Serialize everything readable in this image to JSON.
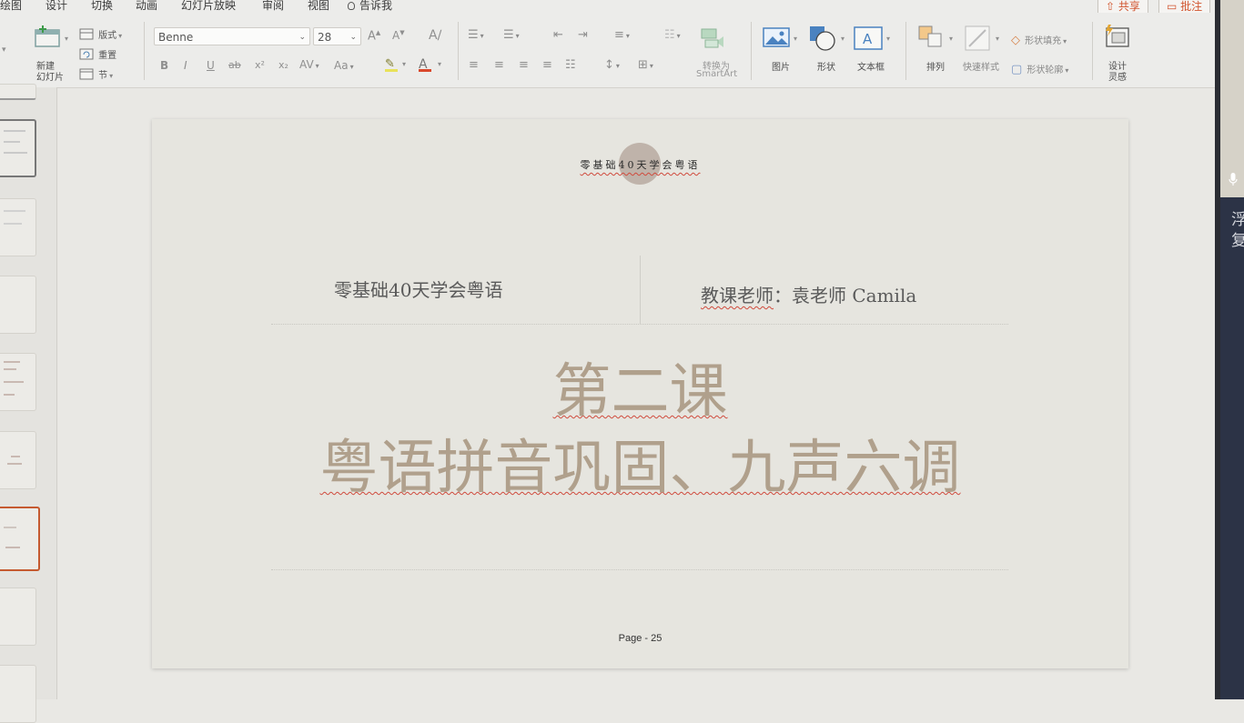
{
  "menubar": {
    "items": [
      "绘图",
      "设计",
      "切换",
      "动画",
      "幻灯片放映",
      "审阅",
      "视图"
    ],
    "tell_me": "告诉我",
    "share": "共享",
    "comments": "批注"
  },
  "ribbon": {
    "new_slide_line1": "新建",
    "new_slide_line2": "幻灯片",
    "layout": "版式",
    "reset": "重置",
    "section": "节",
    "font_name": "Benne",
    "font_size": "28",
    "format_buttons": [
      "B",
      "I",
      "U",
      "ab",
      "x²",
      "x₂",
      "AV",
      "Aa"
    ],
    "convert_line1": "转换为",
    "convert_line2": "SmartArt",
    "picture": "图片",
    "shape": "形状",
    "textbox": "文本框",
    "arrange": "排列",
    "quick_styles": "快速样式",
    "shape_fill": "形状填充",
    "shape_outline": "形状轮廓",
    "designer_line1": "设计",
    "designer_line2": "灵感"
  },
  "slide": {
    "header": "零基础40天学会粤语",
    "left_title": "零基础40天学会粤语",
    "teacher_label": "教课老师",
    "teacher_name": "：袁老师 Camila",
    "main_title_line1": "第二课",
    "main_title_line2": "粤语拼音巩固、九声六调",
    "page": "Page - 25"
  },
  "right_panel": {
    "line1": "浮",
    "line2": "复"
  },
  "colors": {
    "accent": "#d1542e",
    "title_text": "#b0a08c",
    "slide_bg": "#e6e5df",
    "selected_thumb": "#c55a30"
  }
}
